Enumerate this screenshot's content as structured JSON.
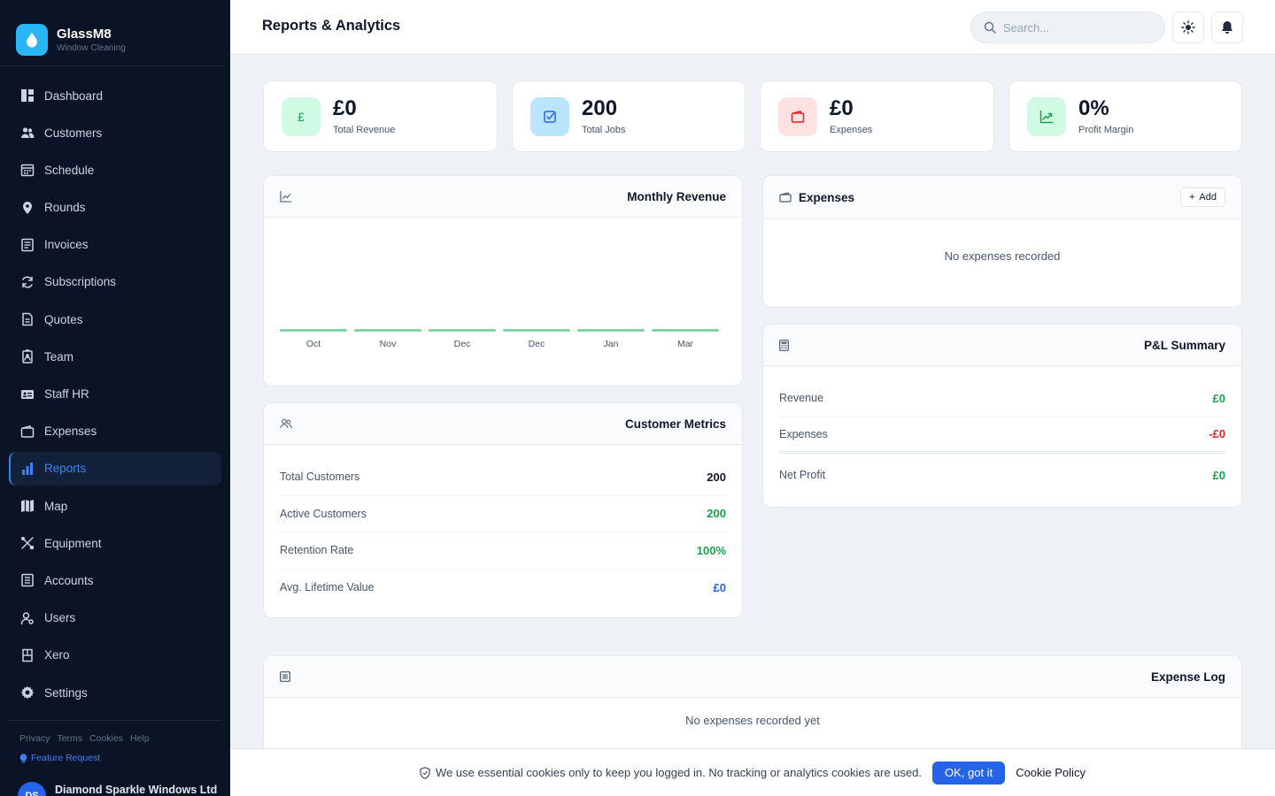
{
  "brand": {
    "name": "GlassM8",
    "subtitle": "Window Cleaning"
  },
  "sidebar": {
    "items": [
      {
        "label": "Dashboard",
        "icon": "dashboard-icon"
      },
      {
        "label": "Customers",
        "icon": "customers-icon"
      },
      {
        "label": "Schedule",
        "icon": "calendar-icon"
      },
      {
        "label": "Rounds",
        "icon": "location-pin-icon"
      },
      {
        "label": "Invoices",
        "icon": "invoice-icon"
      },
      {
        "label": "Subscriptions",
        "icon": "refresh-icon"
      },
      {
        "label": "Quotes",
        "icon": "document-icon"
      },
      {
        "label": "Team",
        "icon": "badge-icon"
      },
      {
        "label": "Staff HR",
        "icon": "id-card-icon"
      },
      {
        "label": "Expenses",
        "icon": "wallet-icon"
      },
      {
        "label": "Reports",
        "icon": "bar-chart-icon",
        "active": true
      },
      {
        "label": "Map",
        "icon": "map-icon"
      },
      {
        "label": "Equipment",
        "icon": "tools-icon"
      },
      {
        "label": "Accounts",
        "icon": "ledger-icon"
      },
      {
        "label": "Users",
        "icon": "user-icon"
      },
      {
        "label": "Xero",
        "icon": "xero-icon"
      },
      {
        "label": "Settings",
        "icon": "gear-icon"
      }
    ],
    "footer_links": [
      "Privacy",
      "Terms",
      "Cookies",
      "Help"
    ],
    "feature_request": "Feature Request",
    "org": {
      "initials": "DS",
      "name": "Diamond Sparkle Windows Ltd"
    }
  },
  "header": {
    "title": "Reports & Analytics",
    "search_placeholder": "Search..."
  },
  "stats": [
    {
      "value": "£0",
      "label": "Total Revenue",
      "icon": "pound-icon",
      "bg": "#d1fae5",
      "fg": "#16a34a"
    },
    {
      "value": "200",
      "label": "Total Jobs",
      "icon": "checkbox-icon",
      "bg": "#bae6fd",
      "fg": "#2563eb"
    },
    {
      "value": "£0",
      "label": "Expenses",
      "icon": "wallet-icon",
      "bg": "#fee2e2",
      "fg": "#dc2626"
    },
    {
      "value": "0%",
      "label": "Profit Margin",
      "icon": "trend-up-icon",
      "bg": "#d1fae5",
      "fg": "#16a34a"
    }
  ],
  "monthly_revenue": {
    "title": "Monthly Revenue",
    "chart_data": {
      "type": "bar",
      "categories": [
        "Oct",
        "Nov",
        "Dec",
        "Dec",
        "Jan",
        "Mar"
      ],
      "values": [
        0,
        0,
        0,
        0,
        0,
        0
      ],
      "title": "Monthly Revenue",
      "xlabel": "",
      "ylabel": "",
      "bar_color": "#86d3a8",
      "grid": false
    }
  },
  "customer_metrics": {
    "title": "Customer Metrics",
    "rows": [
      {
        "label": "Total Customers",
        "value": "200",
        "color": "#0f172a"
      },
      {
        "label": "Active Customers",
        "value": "200",
        "color": "#16a34a"
      },
      {
        "label": "Retention Rate",
        "value": "100%",
        "color": "#16a34a"
      },
      {
        "label": "Avg. Lifetime Value",
        "value": "£0",
        "color": "#2563eb"
      }
    ]
  },
  "expenses_card": {
    "title": "Expenses",
    "add_label": "Add",
    "empty": "No expenses recorded"
  },
  "pl_summary": {
    "title": "P&L Summary",
    "rows": [
      {
        "label": "Revenue",
        "value": "£0",
        "color": "#16a34a"
      },
      {
        "label": "Expenses",
        "value": "-£0",
        "color": "#dc2626"
      },
      {
        "label": "Net Profit",
        "value": "£0",
        "color": "#16a34a"
      }
    ]
  },
  "expense_log": {
    "title": "Expense Log",
    "empty": "No expenses recorded yet"
  },
  "cookie_bar": {
    "text": "We use essential cookies only to keep you logged in. No tracking or analytics cookies are used.",
    "ok_label": "OK, got it",
    "policy_label": "Cookie Policy"
  },
  "colors": {
    "sidebar_bg": "#0b1426",
    "accent": "#3b82f6",
    "brand_logo": "#29b6f6"
  }
}
